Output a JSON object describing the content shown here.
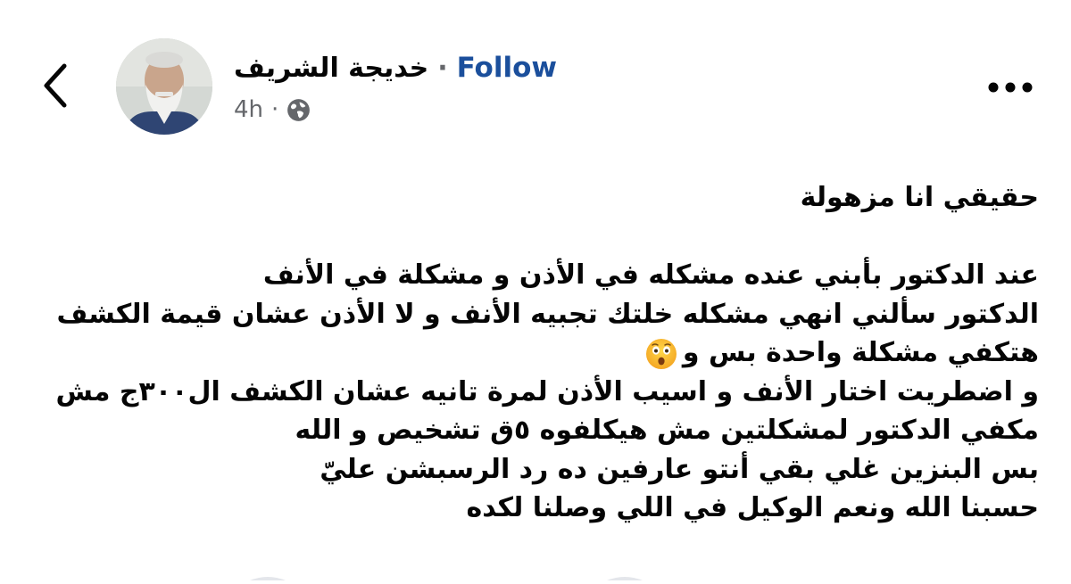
{
  "header": {
    "author_name": "خديجة الشريف",
    "separator": "·",
    "follow_label": "Follow",
    "timestamp": "4h",
    "meta_separator": "·",
    "audience_icon": "globe-icon",
    "back_icon": "chevron-left-icon",
    "more_icon": "more-horizontal-icon"
  },
  "post": {
    "lines": [
      "حقيقي انا مزهولة",
      "",
      "عند الدكتور بأبني عنده مشكله في الأذن و مشكلة في الأنف",
      "الدكتور سألني انهي مشكله خلتك تجبيه الأنف و لا الأذن عشان قيمة الكشف",
      "هتكفي مشكلة واحدة بس و",
      "و اضطريت اختار الأنف و اسيب الأذن لمرة تانيه عشان الكشف ال٣٠٠ج مش",
      "مكفي الدكتور لمشكلتين مش هيكلفوه ٥ق تشخيص و الله",
      "بس البنزين غلي بقي أنتو عارفين ده رد الرسبشن عليّ",
      "حسبنا الله ونعم الوكيل في اللي وصلنا لكده"
    ],
    "emoji": "astonished-face-emoji"
  },
  "colors": {
    "follow": "#1b4f9c",
    "text": "#050505",
    "secondary": "#65676b"
  }
}
